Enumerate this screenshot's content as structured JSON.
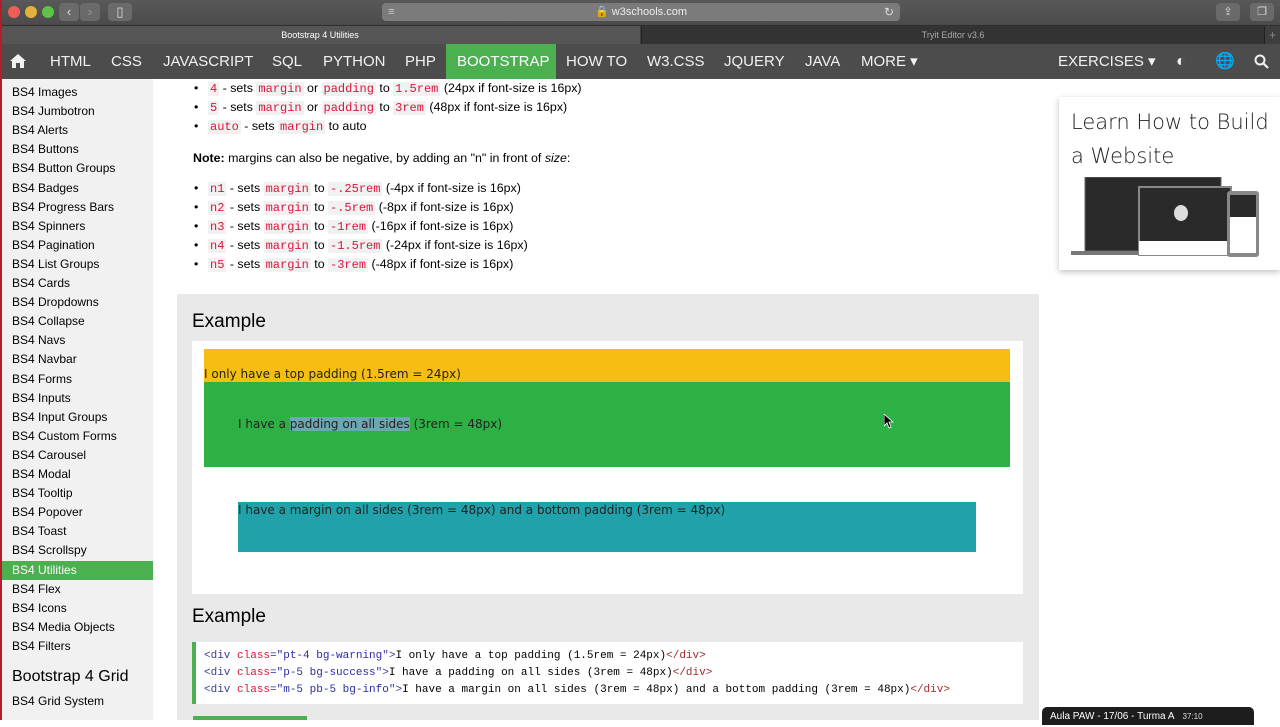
{
  "browser": {
    "url": "w3schools.com",
    "tabs": [
      {
        "label": "Bootstrap 4 Utilities",
        "active": true
      },
      {
        "label": "Tryit Editor v3.6",
        "active": false
      }
    ],
    "new_tab": "+"
  },
  "topnav": {
    "items": [
      "HTML",
      "CSS",
      "JAVASCRIPT",
      "SQL",
      "PYTHON",
      "PHP",
      "BOOTSTRAP",
      "HOW TO",
      "W3.CSS",
      "JQUERY",
      "JAVA",
      "MORE ▾"
    ],
    "active": "BOOTSTRAP",
    "exercises": "EXERCISES ▾",
    "accent": "#4caf50"
  },
  "sidebar": {
    "items": [
      "BS4 Images",
      "BS4 Jumbotron",
      "BS4 Alerts",
      "BS4 Buttons",
      "BS4 Button Groups",
      "BS4 Badges",
      "BS4 Progress Bars",
      "BS4 Spinners",
      "BS4 Pagination",
      "BS4 List Groups",
      "BS4 Cards",
      "BS4 Dropdowns",
      "BS4 Collapse",
      "BS4 Navs",
      "BS4 Navbar",
      "BS4 Forms",
      "BS4 Inputs",
      "BS4 Input Groups",
      "BS4 Custom Forms",
      "BS4 Carousel",
      "BS4 Modal",
      "BS4 Tooltip",
      "BS4 Popover",
      "BS4 Toast",
      "BS4 Scrollspy",
      "BS4 Utilities",
      "BS4 Flex",
      "BS4 Icons",
      "BS4 Media Objects",
      "BS4 Filters"
    ],
    "active": "BS4 Utilities",
    "section_heading": "Bootstrap 4 Grid",
    "section_items": [
      "BS4 Grid System"
    ]
  },
  "content": {
    "size_list": [
      {
        "code": "4",
        "text1": " - sets ",
        "c1": "margin",
        "mid": " or ",
        "c2": "padding",
        "to": " to ",
        "c3": "1.5rem",
        "tail": " (24px if font-size is 16px)"
      },
      {
        "code": "5",
        "text1": " - sets ",
        "c1": "margin",
        "mid": " or ",
        "c2": "padding",
        "to": " to ",
        "c3": "3rem",
        "tail": " (48px if font-size is 16px)"
      },
      {
        "code": "auto",
        "text1": " - sets ",
        "c1": "margin",
        "tail": " to auto"
      }
    ],
    "note_label": "Note:",
    "note_text": " margins can also be negative, by adding an \"n\" in front of ",
    "note_em": "size",
    "note_end": ":",
    "neg_list": [
      {
        "code": "n1",
        "c3": "-.25rem",
        "tail": " (-4px if font-size is 16px)"
      },
      {
        "code": "n2",
        "c3": "-.5rem",
        "tail": " (-8px if font-size is 16px)"
      },
      {
        "code": "n3",
        "c3": "-1rem",
        "tail": " (-16px if font-size is 16px)"
      },
      {
        "code": "n4",
        "c3": "-1.5rem",
        "tail": " (-24px if font-size is 16px)"
      },
      {
        "code": "n5",
        "c3": "-3rem",
        "tail": " (-48px if font-size is 16px)"
      }
    ],
    "neg_sets": " - sets ",
    "neg_margin": "margin",
    "neg_to": " to ",
    "example1": {
      "title": "Example",
      "warning_text": "I only have a top padding (1.5rem = 24px)",
      "success_pre": "I have a ",
      "success_highlight": "padding on all sides",
      "success_post": " (3rem = 48px)",
      "info_text": "I have a margin on all sides (3rem = 48px) and a bottom padding (3rem = 48px)",
      "colors": {
        "warning": "#f7bd12",
        "success": "#2db144",
        "info": "#21a2aa"
      }
    },
    "example2": {
      "title": "Example",
      "code_lines": [
        {
          "cls": "pt-4 bg-warning",
          "text": "I only have a top padding (1.5rem = 24px)"
        },
        {
          "cls": "p-5 bg-success",
          "text": "I have a padding on all sides (3rem = 48px)"
        },
        {
          "cls": "m-5 pb-5 bg-info",
          "text": "I have a margin on all sides (3rem = 48px) and a bottom padding (3rem = 48px)"
        }
      ]
    }
  },
  "ad": {
    "title": "Learn How to Build a Website"
  },
  "overlay": {
    "title": "Aula PAW - 17/06 - Turma A",
    "time": "37:10"
  }
}
